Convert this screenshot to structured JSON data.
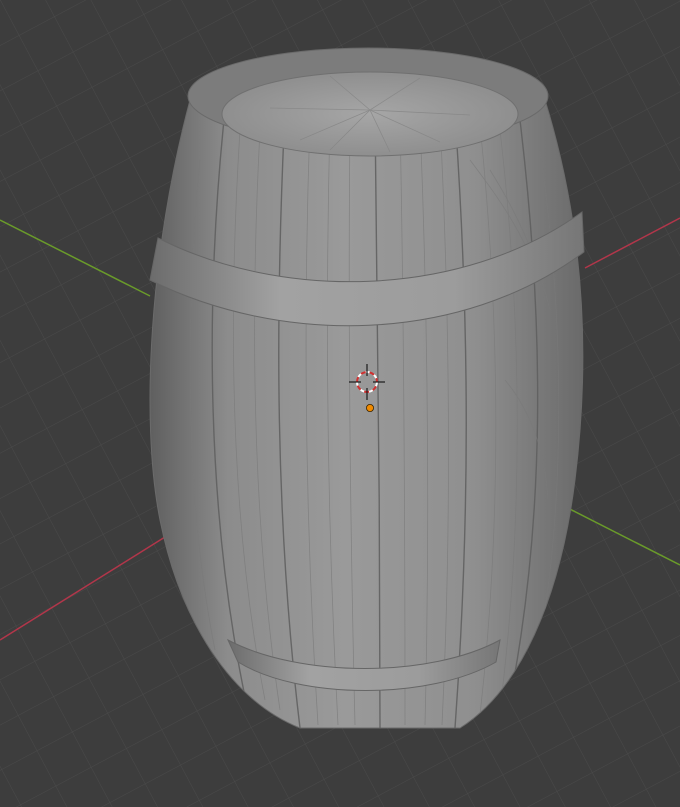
{
  "viewport": {
    "background": "#3d3d3d",
    "grid_color": "#4a4a4a",
    "x_axis_color": "#b2364a",
    "y_axis_color": "#6a9b2a"
  },
  "scene": {
    "object": "wooden-barrel",
    "shading": "solid-gray",
    "object_color": "#8a8a8a"
  },
  "overlays": {
    "cursor_icon": "3d-cursor-icon",
    "origin_icon": "object-origin-icon",
    "origin_color": "#f08a00"
  }
}
